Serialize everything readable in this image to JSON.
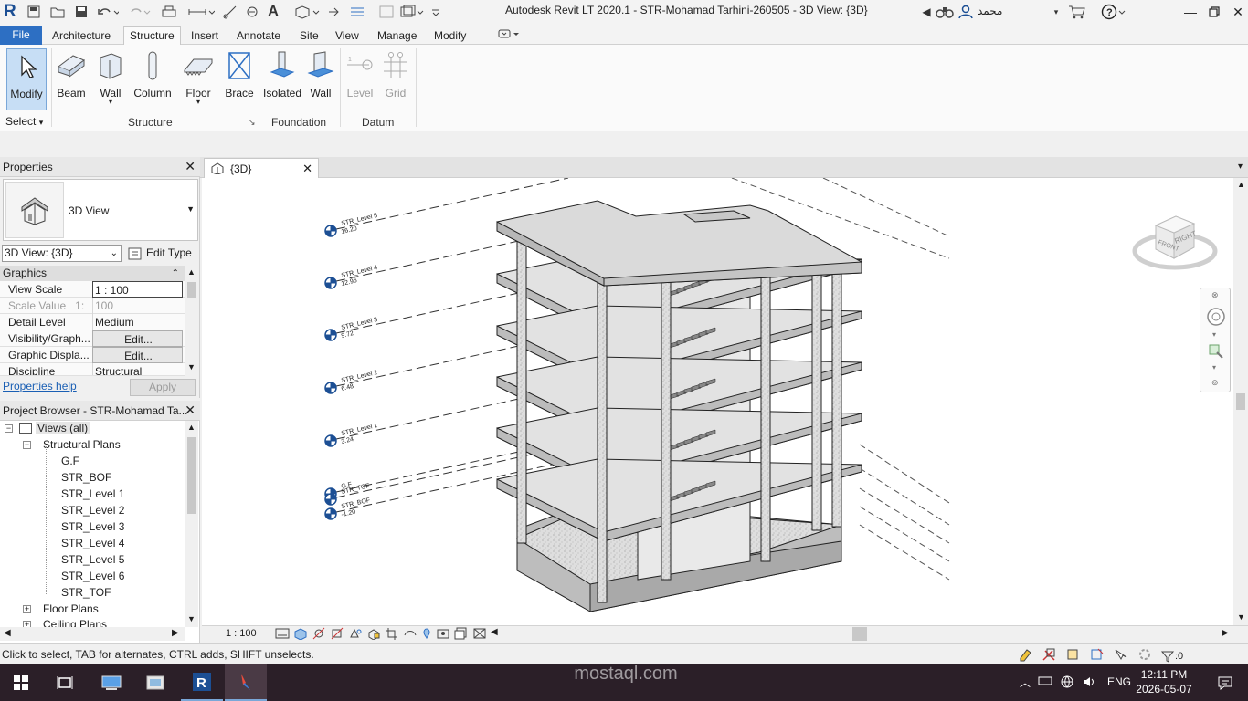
{
  "window": {
    "title": "Autodesk Revit LT 2020.1 - STR-Mohamad Tarhini-260505 - 3D View: {3D}",
    "user": "محمد",
    "logo": "R"
  },
  "tabs": [
    "File",
    "Architecture",
    "Structure",
    "Insert",
    "Annotate",
    "Site",
    "View",
    "Manage",
    "Modify"
  ],
  "ribbon": {
    "modify": "Modify",
    "select": "Select",
    "structure_buttons": [
      "Beam",
      "Wall",
      "Column",
      "Floor",
      "Brace"
    ],
    "foundation_buttons": [
      "Isolated",
      "Wall"
    ],
    "datum_buttons": [
      "Level",
      "Grid"
    ],
    "panels": {
      "structure": "Structure",
      "foundation": "Foundation",
      "datum": "Datum"
    }
  },
  "properties": {
    "title": "Properties",
    "type_name": "3D View",
    "instance": "3D View: {3D}",
    "edit_type": "Edit Type",
    "group": "Graphics",
    "rows": [
      {
        "key": "View Scale",
        "value": "1 : 100"
      },
      {
        "key": "Scale Value",
        "key_suffix": "1:",
        "value": "100"
      },
      {
        "key": "Detail Level",
        "value": "Medium"
      },
      {
        "key": "Visibility/Graph...",
        "value": "Edit..."
      },
      {
        "key": "Graphic Displa...",
        "value": "Edit..."
      },
      {
        "key": "Discipline",
        "value": "Structural"
      }
    ],
    "help": "Properties help",
    "apply": "Apply"
  },
  "browser": {
    "title": "Project Browser - STR-Mohamad Ta...",
    "root": "Views (all)",
    "group": "Structural Plans",
    "items": [
      "G.F",
      "STR_BOF",
      "STR_Level 1",
      "STR_Level 2",
      "STR_Level 3",
      "STR_Level 4",
      "STR_Level 5",
      "STR_Level 6",
      "STR_TOF"
    ],
    "more": [
      "Floor Plans",
      "Ceiling Plans"
    ]
  },
  "view": {
    "tab": "{3D}",
    "scale": "1 : 100",
    "levels": [
      {
        "name": "STR_Level 5",
        "elev": "16.20"
      },
      {
        "name": "STR_Level 4",
        "elev": "12.96"
      },
      {
        "name": "STR_Level 3",
        "elev": "9.72"
      },
      {
        "name": "STR_Level 2",
        "elev": "6.48"
      },
      {
        "name": "STR_Level 1",
        "elev": "3.24"
      },
      {
        "name": "G.F",
        "elev": ""
      },
      {
        "name": "STR_TOF",
        "elev": ""
      },
      {
        "name": "STR_BOF",
        "elev": "-1.20"
      }
    ],
    "viewcube": {
      "front": "FRONT",
      "right": "RIGHT"
    }
  },
  "status": {
    "text": "Click to select, TAB for alternates, CTRL adds, SHIFT unselects.",
    "filter_count": ":0"
  },
  "taskbar": {
    "lang": "ENG",
    "time": "12:11 PM",
    "date": "2026-05-07"
  },
  "watermark": {
    "text": "mostaql.com"
  }
}
